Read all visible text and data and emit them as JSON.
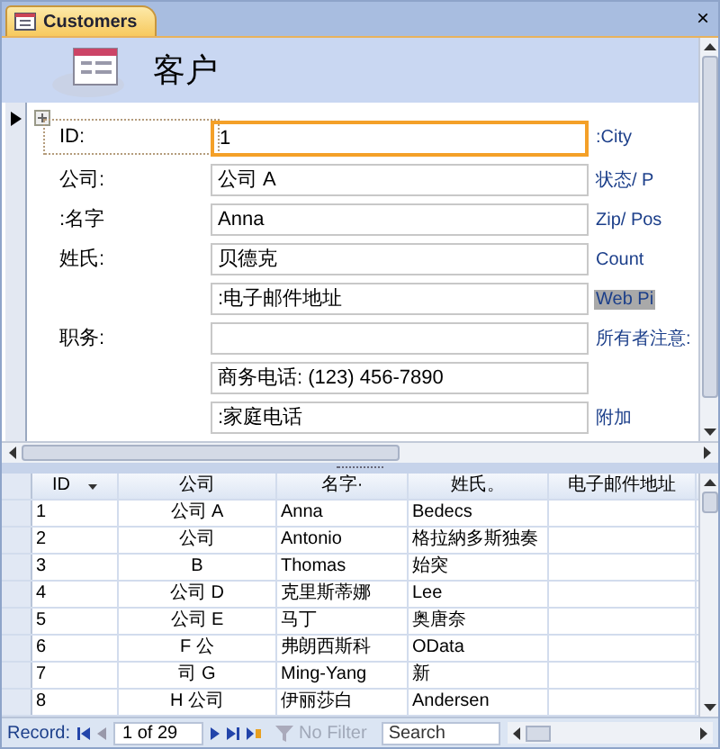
{
  "window": {
    "tab": "Customers",
    "close": "×"
  },
  "form": {
    "title": "客户",
    "rows": [
      {
        "label": "ID:",
        "value": "1",
        "focused": true,
        "side": ":City"
      },
      {
        "label": "公司:",
        "value": "公司 A",
        "focused": false,
        "side": "状态/ P"
      },
      {
        "label": ":名字",
        "value": "Anna",
        "focused": false,
        "side": "Zip/ Pos"
      },
      {
        "label": "姓氏:",
        "value": "贝德克",
        "focused": false,
        "side": "Count"
      },
      {
        "value": ":电子邮件地址",
        "focused": false,
        "side": "Web Pi",
        "side_selected": true
      },
      {
        "label": "职务:",
        "value": "",
        "focused": false,
        "side": "所有者注意:"
      },
      {
        "value": "商务电话: (123)  456-7890",
        "focused": false
      },
      {
        "value": ":家庭电话",
        "focused": false,
        "side": "附加"
      }
    ]
  },
  "table": {
    "columns": [
      {
        "label": "ID",
        "sort": true
      },
      {
        "label": "公司",
        "sort": false
      },
      {
        "label": "名字·",
        "sort": false
      },
      {
        "label": "姓氏。",
        "sort": false
      },
      {
        "label": "电子邮件地址",
        "sort": false
      }
    ],
    "rows": [
      [
        "1",
        "公司 A",
        "Anna",
        "Bedecs",
        ""
      ],
      [
        "2",
        "公司",
        "Antonio",
        "格拉納多斯独奏",
        ""
      ],
      [
        "3",
        "B",
        "Thomas",
        "始突",
        ""
      ],
      [
        "4",
        "公司 D",
        "克里斯蒂娜",
        "Lee",
        ""
      ],
      [
        "5",
        "公司 E",
        "马丁",
        "奥唐奈",
        ""
      ],
      [
        "6",
        "F 公",
        "弗朗西斯科",
        "OData",
        ""
      ],
      [
        "7",
        "司 G",
        "Ming-Yang",
        "新",
        ""
      ],
      [
        "8",
        "H 公司",
        "伊丽莎白",
        "Andersen",
        ""
      ]
    ]
  },
  "status_bar": {
    "record_label": "Record:",
    "position": "1 of 29",
    "filter": "No Filter",
    "filter_disabled": true,
    "search": "Search"
  }
}
